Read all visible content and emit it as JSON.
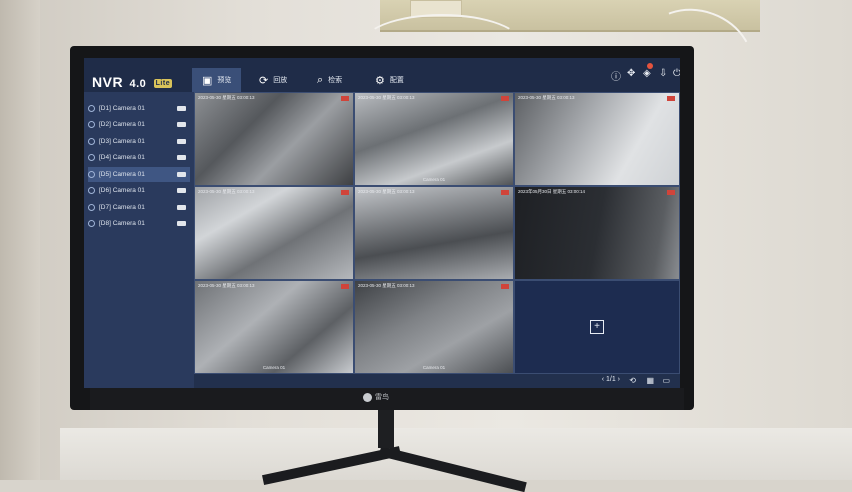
{
  "app": {
    "brand": "NVR",
    "version": "4.0",
    "edition": "Lite"
  },
  "tabs": [
    {
      "label": "预览",
      "icon": "camera-icon",
      "active": true
    },
    {
      "label": "回放",
      "icon": "playback-icon",
      "active": false
    },
    {
      "label": "检索",
      "icon": "search-icon",
      "active": false
    },
    {
      "label": "配置",
      "icon": "gear-icon",
      "active": false
    }
  ],
  "top_icons": [
    "info-icon",
    "layout-icon",
    "notification-icon",
    "download-icon",
    "power-icon"
  ],
  "cameras": [
    {
      "label": "[D1] Camera 01"
    },
    {
      "label": "[D2] Camera 01"
    },
    {
      "label": "[D3] Camera 01"
    },
    {
      "label": "[D4] Camera 01"
    },
    {
      "label": "[D5] Camera 01",
      "selected": true
    },
    {
      "label": "[D6] Camera 01"
    },
    {
      "label": "[D7] Camera 01"
    },
    {
      "label": "[D8] Camera 01"
    }
  ],
  "feeds": [
    {
      "timestamp": "2023-05-30 星期五 03:00:13",
      "name": ""
    },
    {
      "timestamp": "2023-05-30 星期五 03:00:13",
      "name": "Camera 01"
    },
    {
      "timestamp": "2023-05-30 星期五 03:00:13",
      "name": ""
    },
    {
      "timestamp": "2023-05-30 星期五 03:00:13",
      "name": ""
    },
    {
      "timestamp": "2023-05-30 星期五 03:00:13",
      "name": ""
    },
    {
      "timestamp": "2023年05月30日 星期五 03:00:14",
      "name": ""
    },
    {
      "timestamp": "2023-05-30 星期五 03:00:13",
      "name": "Camera 01"
    },
    {
      "timestamp": "2023-05-30 星期五 03:00:13",
      "name": "Camera 01"
    }
  ],
  "pager": {
    "text": "1/1"
  },
  "monitor_brand": "雷鸟"
}
